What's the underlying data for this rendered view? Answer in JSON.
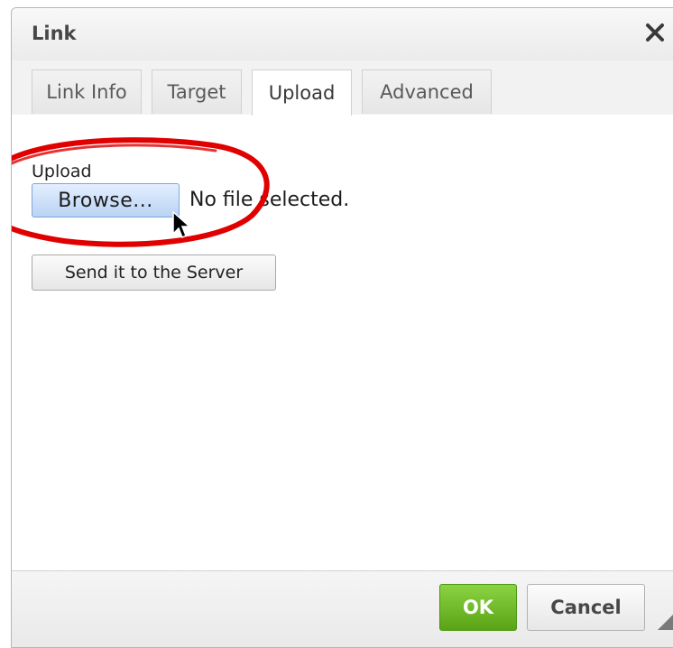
{
  "dialog": {
    "title": "Link",
    "close_icon": "close-icon"
  },
  "tabs": [
    {
      "label": "Link Info",
      "active": false
    },
    {
      "label": "Target",
      "active": false
    },
    {
      "label": "Upload",
      "active": true
    },
    {
      "label": "Advanced",
      "active": false
    }
  ],
  "upload": {
    "label": "Upload",
    "browse_label": "Browse...",
    "file_status": "No file selected.",
    "send_label": "Send it to the Server"
  },
  "footer": {
    "ok_label": "OK",
    "cancel_label": "Cancel"
  },
  "colors": {
    "ok_green": "#6ab92a",
    "annotation_red": "#e00000",
    "browse_blue": "#c7dcf6"
  },
  "icons": {
    "close": "close-icon",
    "cursor": "mouse-pointer-icon",
    "resize": "resize-grip-icon"
  }
}
